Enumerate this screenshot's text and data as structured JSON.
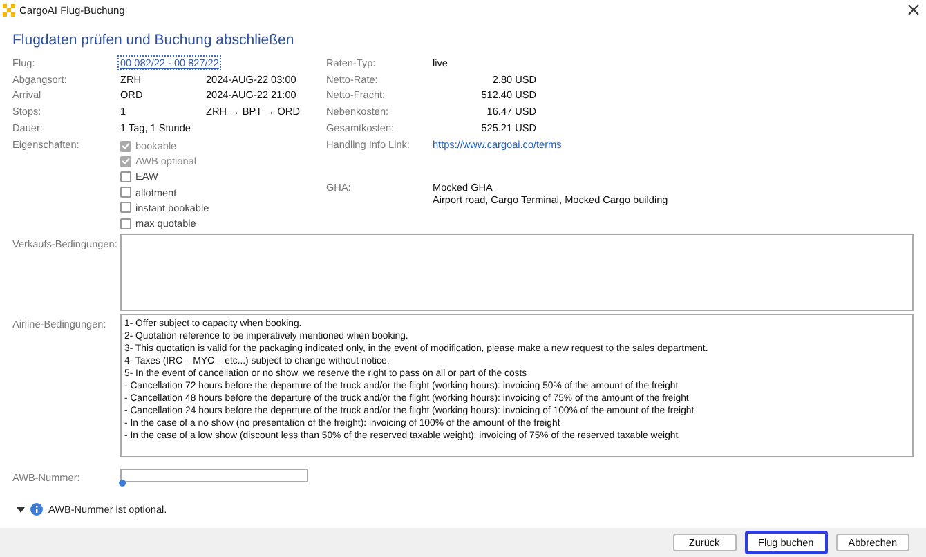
{
  "window": {
    "title": "CargoAI Flug-Buchung"
  },
  "heading": "Flugdaten prüfen und Buchung abschließen",
  "details": [
    {
      "label": "Flug:",
      "value": "00 082/22 - 00 827/22",
      "kind": "focused"
    },
    {
      "label": "Abgangsort:",
      "value": "ZRH",
      "extra": "2024-AUG-22 03:00",
      "kind": "text"
    },
    {
      "label": "Arrival",
      "value": "ORD",
      "extra": "2024-AUG-22 21:00",
      "kind": "text"
    },
    {
      "label": "Stops:",
      "value": "1",
      "extra": "ZRH → BPT → ORD",
      "kind": "text"
    },
    {
      "label": "Dauer:",
      "value": "1 Tag, 1 Stunde",
      "kind": "text"
    }
  ],
  "rates": [
    {
      "label": "Raten-Typ:",
      "value": "live",
      "kind": "text"
    },
    {
      "label": "Netto-Rate:",
      "value": "2.80 USD",
      "kind": "amount"
    },
    {
      "label": "Netto-Fracht:",
      "value": "512.40 USD",
      "kind": "amount"
    },
    {
      "label": "Nebenkosten:",
      "value": "16.47 USD",
      "kind": "amount"
    },
    {
      "label": "Gesamtkosten:",
      "value": "525.21 USD",
      "kind": "amount"
    }
  ],
  "properties": {
    "label": "Eigenschaften:",
    "items": [
      {
        "label": "bookable",
        "checked": true,
        "disabled": true
      },
      {
        "label": "AWB optional",
        "checked": true,
        "disabled": true
      },
      {
        "label": "EAW",
        "checked": false,
        "disabled": false
      },
      {
        "label": "allotment",
        "checked": false,
        "disabled": false
      },
      {
        "label": "instant bookable",
        "checked": false,
        "disabled": false
      },
      {
        "label": "max quotable",
        "checked": false,
        "disabled": false
      }
    ]
  },
  "handling": {
    "label": "Handling Info Link:",
    "link": "https://www.cargoai.co/terms"
  },
  "gha": {
    "label": "GHA:",
    "lines": [
      "Mocked GHA",
      "Airport road, Cargo Terminal, Mocked Cargo building"
    ]
  },
  "sales_conditions": {
    "label": "Verkaufs-Bedingungen:"
  },
  "airline_conditions": {
    "label": "Airline-Bedingungen:",
    "lines": [
      "1- Offer subject to capacity when booking.",
      "2- Quotation reference to be imperatively mentioned when booking.",
      "3- This quotation is valid for the packaging indicated only, in the event of modification, please make a new request to the sales department.",
      "4- Taxes (IRC – MYC – etc...) subject to change without notice.",
      "5- In the event of cancellation or no show, we reserve the right to pass on all or part of the costs",
      "- Cancellation 72 hours before the departure of the truck and/or the flight (working hours): invoicing 50% of the amount of the freight",
      "- Cancellation 48 hours before the departure of the truck and/or the flight (working hours): invoicing of 75% of the amount of the freight",
      "- Cancellation 24 hours before the departure of the truck and/or the flight (working hours): invoicing of 100% of the amount of the freight",
      "- In the case of a no show (no presentation of the freight): invoicing of 100% of the amount of the freight",
      "- In the case of a low show (discount less than 50% of the reserved taxable weight): invoicing of 75% of the reserved taxable weight"
    ]
  },
  "awb": {
    "label": "AWB-Nummer:"
  },
  "note": {
    "text": "AWB-Nummer ist optional.",
    "expanded": true
  },
  "buttons": [
    {
      "label": "Zurück",
      "focused": false
    },
    {
      "label": "Flug buchen",
      "focused": true
    },
    {
      "label": "Abbrechen",
      "focused": false
    }
  ]
}
